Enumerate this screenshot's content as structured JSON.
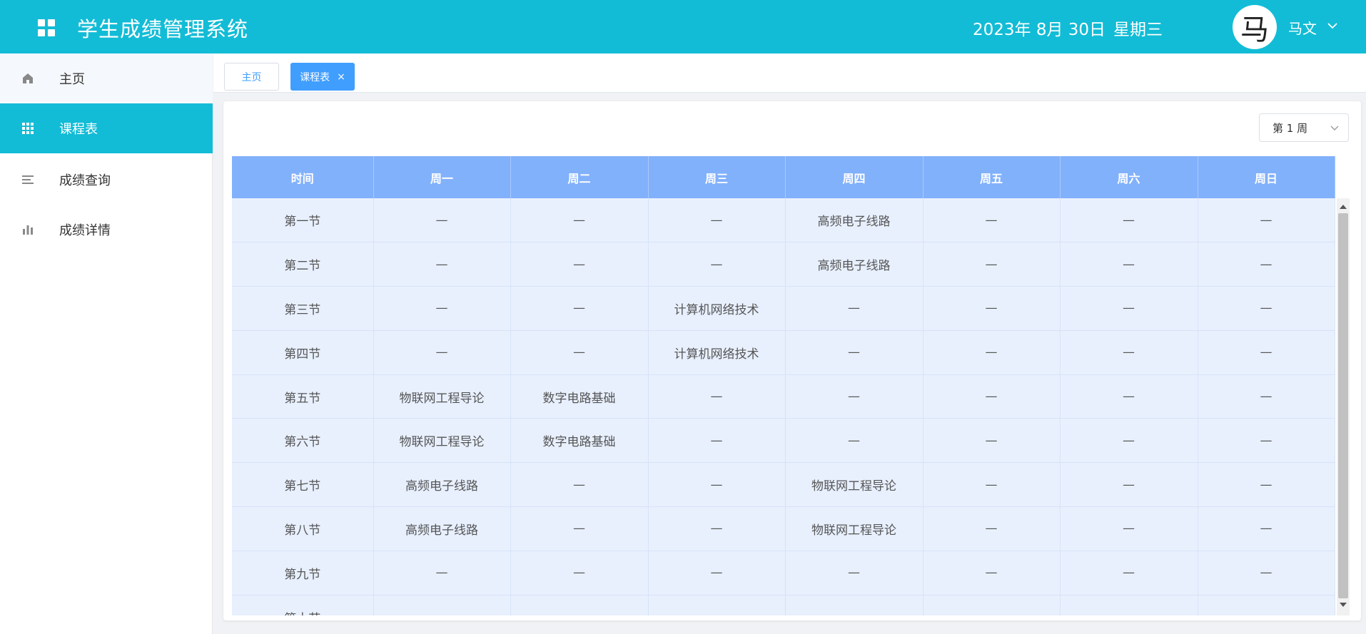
{
  "header": {
    "title": "学生成绩管理系统",
    "date": "2023年 8月 30日",
    "weekday": "星期三",
    "avatar_char": "马",
    "user_name": "马文"
  },
  "sidebar": {
    "items": [
      {
        "label": "主页",
        "icon": "home-icon"
      },
      {
        "label": "课程表",
        "icon": "grid-icon"
      },
      {
        "label": "成绩查询",
        "icon": "list-icon"
      },
      {
        "label": "成绩详情",
        "icon": "bar-chart-icon"
      }
    ]
  },
  "tabs": {
    "home_label": "主页",
    "current_label": "课程表",
    "close_glyph": "×"
  },
  "week_select": {
    "value": "第 1 周"
  },
  "table": {
    "headers": [
      "时间",
      "周一",
      "周二",
      "周三",
      "周四",
      "周五",
      "周六",
      "周日"
    ],
    "rows": [
      [
        "第一节",
        "—",
        "—",
        "—",
        "高频电子线路",
        "—",
        "—",
        "—"
      ],
      [
        "第二节",
        "—",
        "—",
        "—",
        "高频电子线路",
        "—",
        "—",
        "—"
      ],
      [
        "第三节",
        "—",
        "—",
        "计算机网络技术",
        "—",
        "—",
        "—",
        "—"
      ],
      [
        "第四节",
        "—",
        "—",
        "计算机网络技术",
        "—",
        "—",
        "—",
        "—"
      ],
      [
        "第五节",
        "物联网工程导论",
        "数字电路基础",
        "—",
        "—",
        "—",
        "—",
        "—"
      ],
      [
        "第六节",
        "物联网工程导论",
        "数字电路基础",
        "—",
        "—",
        "—",
        "—",
        "—"
      ],
      [
        "第七节",
        "高频电子线路",
        "—",
        "—",
        "物联网工程导论",
        "—",
        "—",
        "—"
      ],
      [
        "第八节",
        "高频电子线路",
        "—",
        "—",
        "物联网工程导论",
        "—",
        "—",
        "—"
      ],
      [
        "第九节",
        "—",
        "—",
        "—",
        "—",
        "—",
        "—",
        "—"
      ],
      [
        "第十节",
        "—",
        "—",
        "—",
        "—",
        "—",
        "—",
        "—"
      ]
    ]
  },
  "colors": {
    "header_bg": "#12bcd6",
    "table_header_bg": "#82b1fb",
    "table_cell_bg": "#e8f0fe",
    "tab_active_bg": "#409eff"
  }
}
